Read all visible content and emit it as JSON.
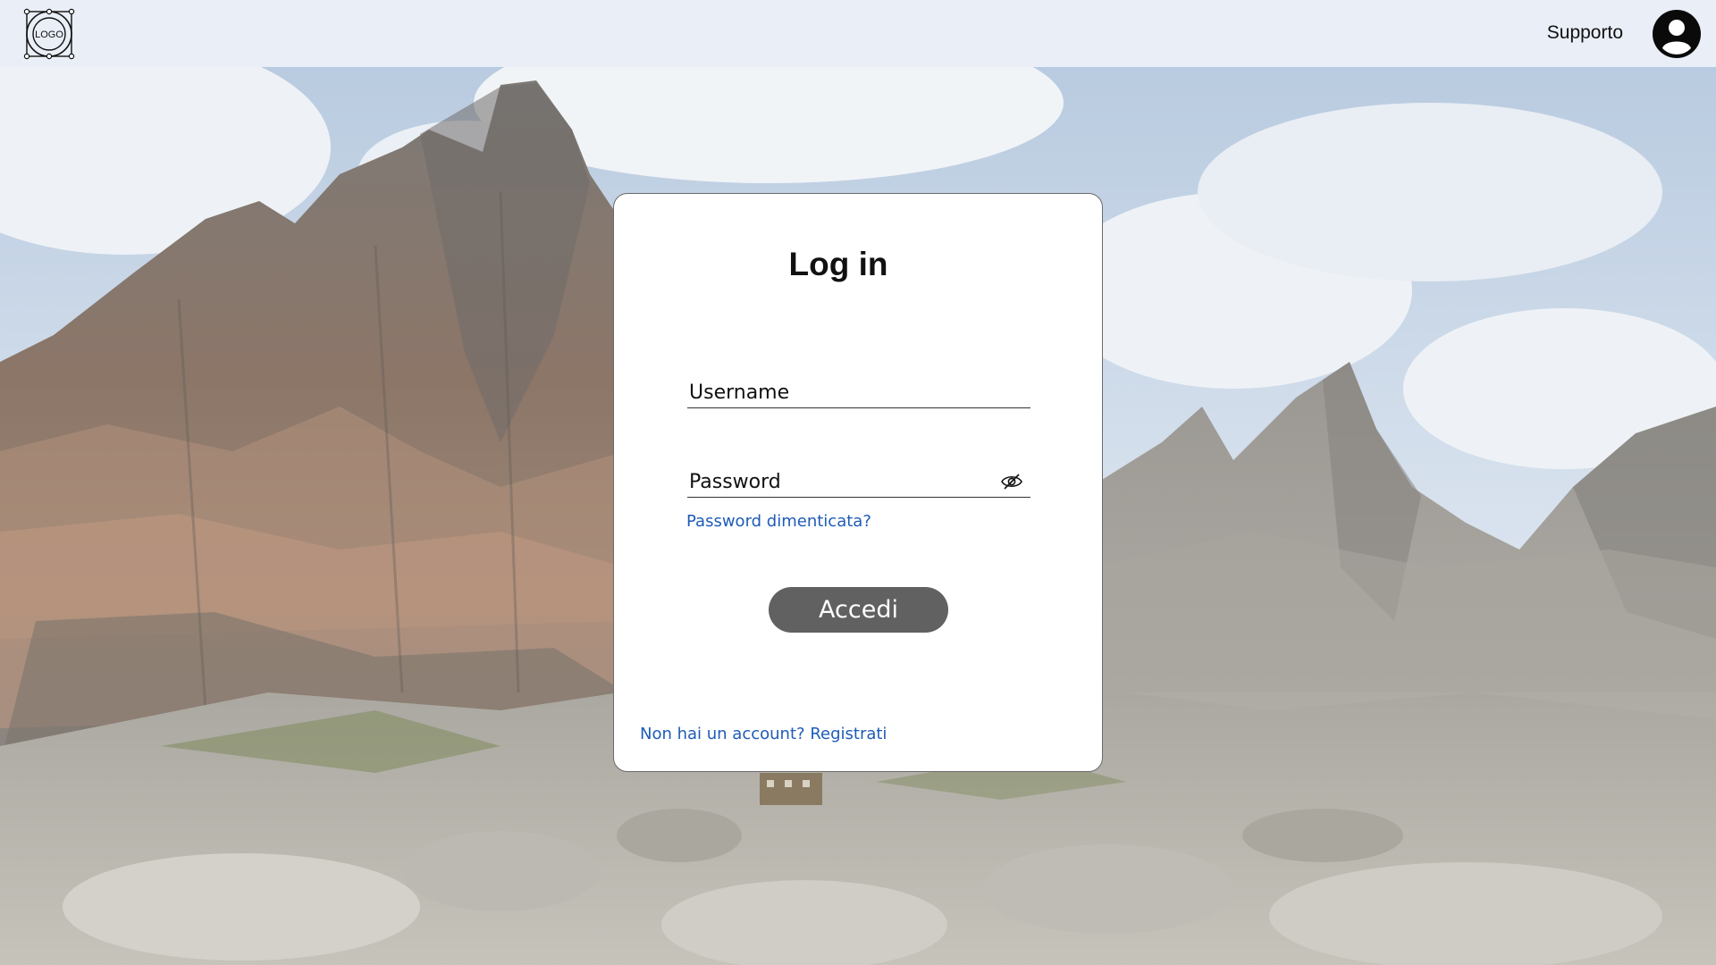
{
  "header": {
    "logo_text": "LOGO",
    "support_label": "Supporto",
    "avatar_icon": "user-circle-icon"
  },
  "login": {
    "title": "Log in",
    "username_placeholder": "Username",
    "password_placeholder": "Password",
    "password_toggle_icon": "eye-off-icon",
    "forgot_password": "Password dimenticata?",
    "submit_label": "Accedi",
    "register_prompt": "Non hai un account?",
    "register_link": "Registrati"
  },
  "colors": {
    "topbar_bg": "#e9eef7",
    "link": "#1e5bb8",
    "button_bg": "#616161",
    "card_bg": "#ffffff"
  }
}
